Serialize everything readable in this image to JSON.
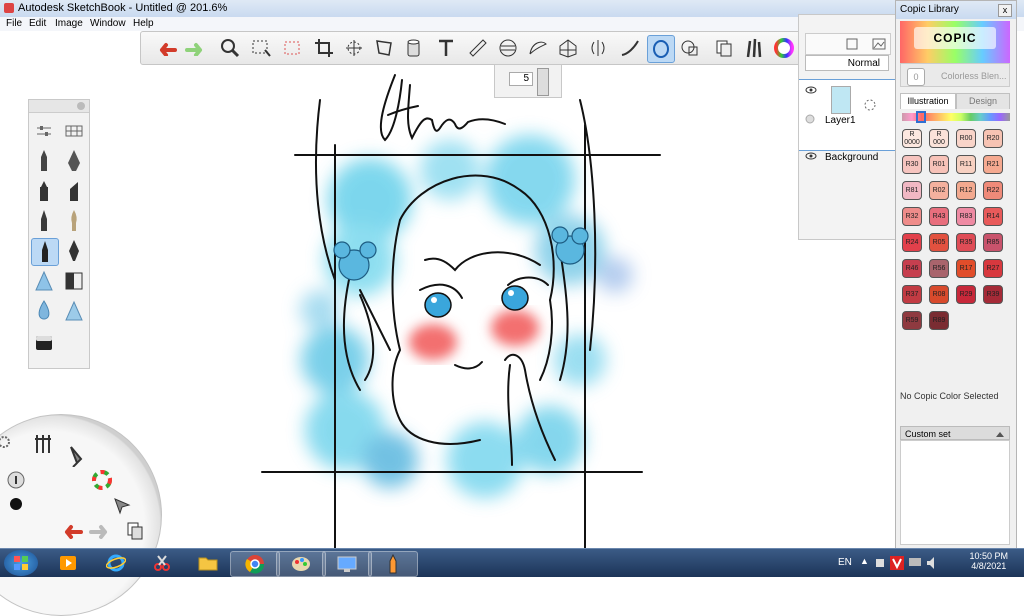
{
  "window": {
    "title": "Autodesk SketchBook - Untitled @ 201.6%"
  },
  "menu": [
    "File",
    "Edit",
    "Image",
    "Window",
    "Help"
  ],
  "toolbar": {
    "brush_size": "5"
  },
  "layers": {
    "blend_mode": "Normal",
    "items": [
      {
        "name": "Layer1"
      },
      {
        "name": "Background"
      }
    ]
  },
  "copic": {
    "title": "Copic Library",
    "close": "x",
    "logo": "COPIC",
    "colorless": "Colorless Blen...",
    "colorless_code": "0",
    "tabs": [
      "Illustration",
      "Design"
    ],
    "swatches": [
      {
        "code": "R\n0000",
        "color": "#fde8e0"
      },
      {
        "code": "R\n000",
        "color": "#fbe2d9"
      },
      {
        "code": "R00",
        "color": "#f9d4c9"
      },
      {
        "code": "R20",
        "color": "#f7c3b3"
      },
      {
        "code": "R30",
        "color": "#f6c4bf"
      },
      {
        "code": "R01",
        "color": "#f7c2b8"
      },
      {
        "code": "R11",
        "color": "#f7d0c1"
      },
      {
        "code": "R21",
        "color": "#f5a990"
      },
      {
        "code": "R81",
        "color": "#f1b8c4"
      },
      {
        "code": "R02",
        "color": "#f4b19e"
      },
      {
        "code": "R12",
        "color": "#f3a98f"
      },
      {
        "code": "R22",
        "color": "#ef8a79"
      },
      {
        "code": "R32",
        "color": "#ef8c8a"
      },
      {
        "code": "R43",
        "color": "#e86e7d"
      },
      {
        "code": "R83",
        "color": "#ee8aa3"
      },
      {
        "code": "R14",
        "color": "#e85a5a"
      },
      {
        "code": "R24",
        "color": "#e2404b"
      },
      {
        "code": "R05",
        "color": "#e2513f"
      },
      {
        "code": "R35",
        "color": "#df4c56"
      },
      {
        "code": "R85",
        "color": "#c9536c"
      },
      {
        "code": "R46",
        "color": "#c63f4f"
      },
      {
        "code": "R56",
        "color": "#a9646c"
      },
      {
        "code": "R17",
        "color": "#e14d2a"
      },
      {
        "code": "R27",
        "color": "#d8383e"
      },
      {
        "code": "R37",
        "color": "#c23b43"
      },
      {
        "code": "R08",
        "color": "#d84a2c"
      },
      {
        "code": "R29",
        "color": "#c7283a"
      },
      {
        "code": "R39",
        "color": "#a52a37"
      },
      {
        "code": "R59",
        "color": "#8f3a40"
      },
      {
        "code": "R89",
        "color": "#7a2c32"
      }
    ],
    "no_selection": "No Copic Color Selected",
    "custom_set": "Custom set"
  },
  "taskbar": {
    "language": "EN",
    "time": "10:50 PM",
    "date": "4/8/2021"
  },
  "colors": {
    "accent": "#6aa0d8",
    "blush": "#f36f6f",
    "watercolor": "#66d0ea"
  }
}
